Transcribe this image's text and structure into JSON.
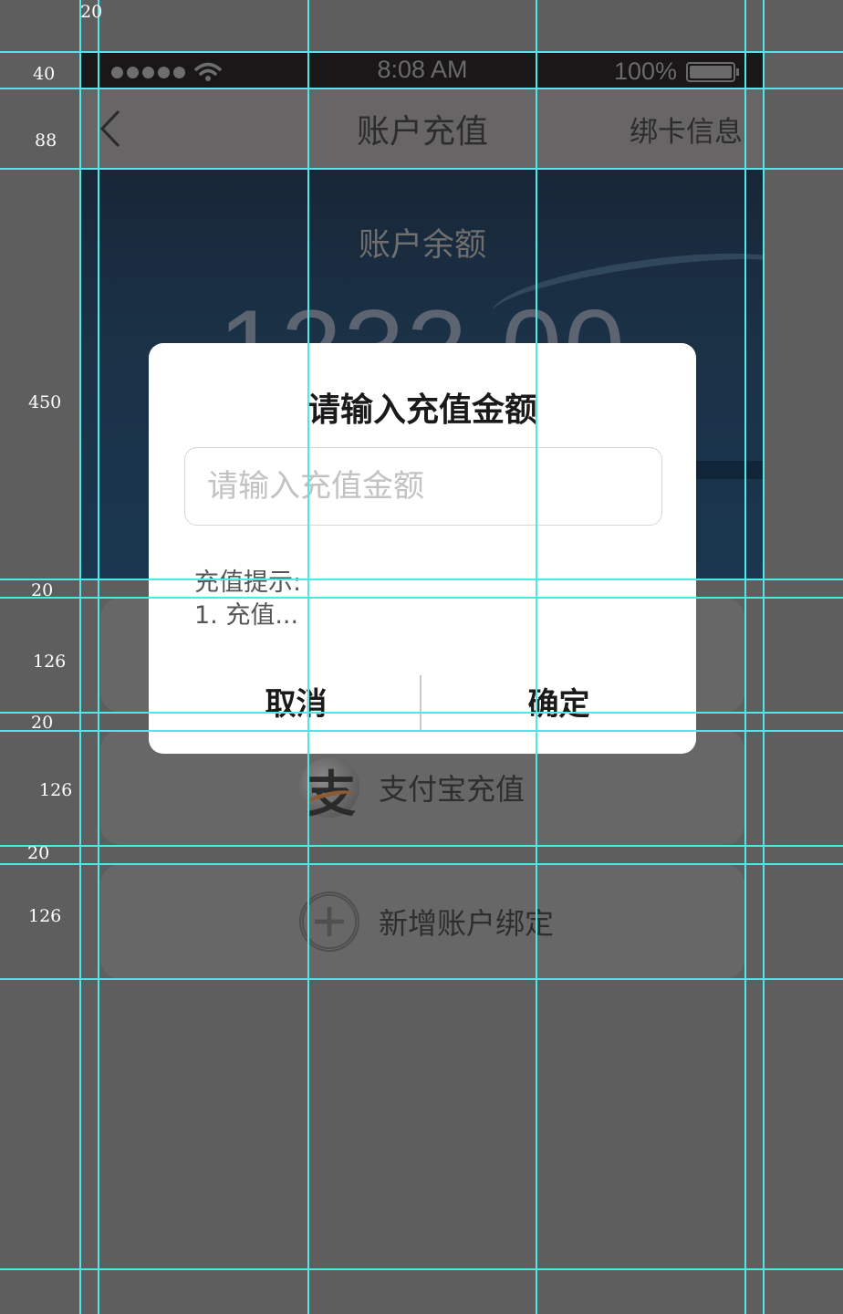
{
  "status_bar": {
    "time": "8:08 AM",
    "battery": "100%"
  },
  "nav": {
    "title": "账户充值",
    "right_action": "绑卡信息"
  },
  "account": {
    "balance_label": "账户余额",
    "balance": "1232.00"
  },
  "cards": [
    {
      "label": "支付宝充值",
      "icon": "alipay-icon"
    },
    {
      "label": "新增账户绑定",
      "icon": "plus-icon"
    }
  ],
  "modal": {
    "title": "请输入充值金额",
    "input_placeholder": "请输入充值金额",
    "input_value": "",
    "tip_title": "充值提示:",
    "tip_text": "1. 充值...",
    "cancel_label": "取消",
    "confirm_label": "确定"
  },
  "annotations": {
    "m20a": "20",
    "m40": "40",
    "m88": "88",
    "m450": "450",
    "m20b": "20",
    "m126a": "126",
    "m20c": "20",
    "m126b": "126",
    "m20d": "20",
    "m126c": "126"
  }
}
